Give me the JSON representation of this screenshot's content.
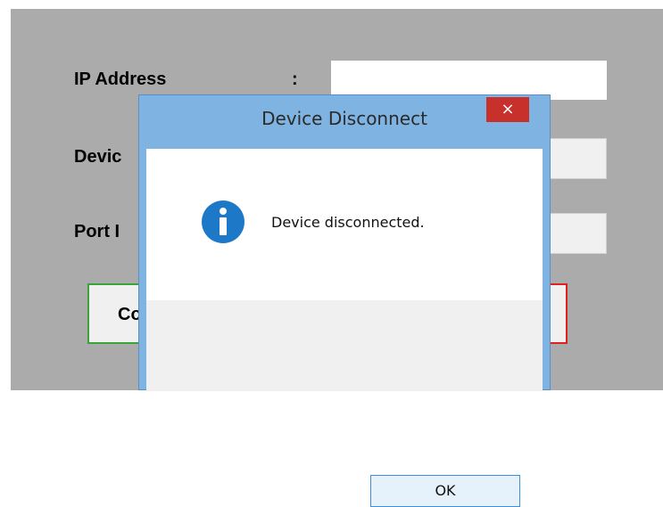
{
  "form": {
    "ip_label": "IP Address",
    "device_label_visible": "Devic",
    "port_label_visible": "Port I",
    "colon": ":",
    "connect_button_visible": "Co"
  },
  "dialog": {
    "title": "Device Disconnect",
    "close_symbol": "×",
    "icon": "info-icon",
    "message": "Device disconnected.",
    "ok_label": "OK"
  },
  "colors": {
    "app_background": "#ababab",
    "dialog_frame": "#7fb3e1",
    "close_button": "#c7302b",
    "connect_border": "#3aa33a",
    "disconnect_border": "#e02020",
    "info_icon": "#1e78c8"
  }
}
